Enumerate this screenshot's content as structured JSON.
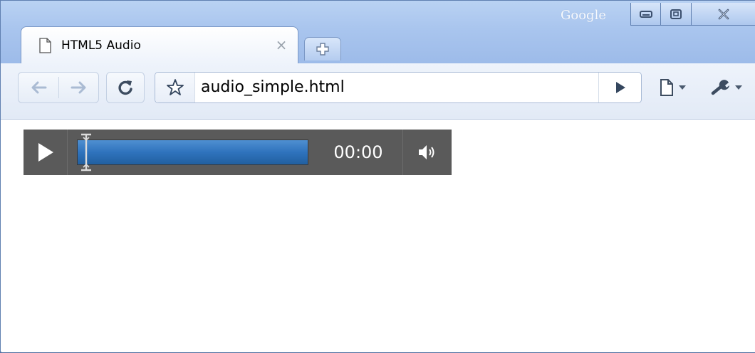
{
  "window": {
    "brand": "Google",
    "controls": [
      "minimize",
      "maximize",
      "close"
    ]
  },
  "tabs": [
    {
      "title": "HTML5 Audio",
      "icon": "page-icon",
      "close_icon": "close-tab-icon"
    }
  ],
  "new_tab_icon": "new-tab-icon",
  "toolbar": {
    "back_icon": "back-arrow-icon",
    "forward_icon": "forward-arrow-icon",
    "reload_icon": "reload-icon",
    "star_icon": "star-icon",
    "url": "audio_simple.html",
    "go_icon": "go-arrow-icon",
    "page_menu_icon": "page-menu-icon",
    "tools_menu_icon": "wrench-icon"
  },
  "audio_player": {
    "play_icon": "play-icon",
    "time": "00:00",
    "progress": 0,
    "volume_icon": "speaker-icon"
  },
  "colors": {
    "titlebar": "#a9c5ee",
    "player_bg": "#5a5a5a",
    "track": "#2f73bd"
  }
}
